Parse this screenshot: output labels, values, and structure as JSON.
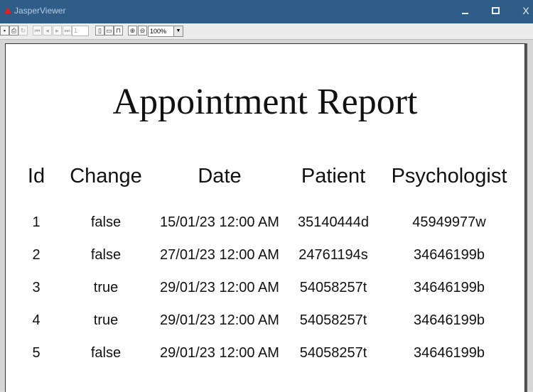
{
  "window": {
    "title": "JasperViewer",
    "close_glyph": "X"
  },
  "toolbar": {
    "page_number": "1",
    "zoom": "100%"
  },
  "report": {
    "title": "Appointment Report",
    "columns": [
      "Id",
      "Change",
      "Date",
      "Patient",
      "Psychologist"
    ],
    "rows": [
      [
        "1",
        "false",
        "15/01/23 12:00 AM",
        "35140444d",
        "45949977w"
      ],
      [
        "2",
        "false",
        "27/01/23 12:00 AM",
        "24761194s",
        "34646199b"
      ],
      [
        "3",
        "true",
        "29/01/23 12:00 AM",
        "54058257t",
        "34646199b"
      ],
      [
        "4",
        "true",
        "29/01/23 12:00 AM",
        "54058257t",
        "34646199b"
      ],
      [
        "5",
        "false",
        "29/01/23 12:00 AM",
        "54058257t",
        "34646199b"
      ]
    ]
  }
}
